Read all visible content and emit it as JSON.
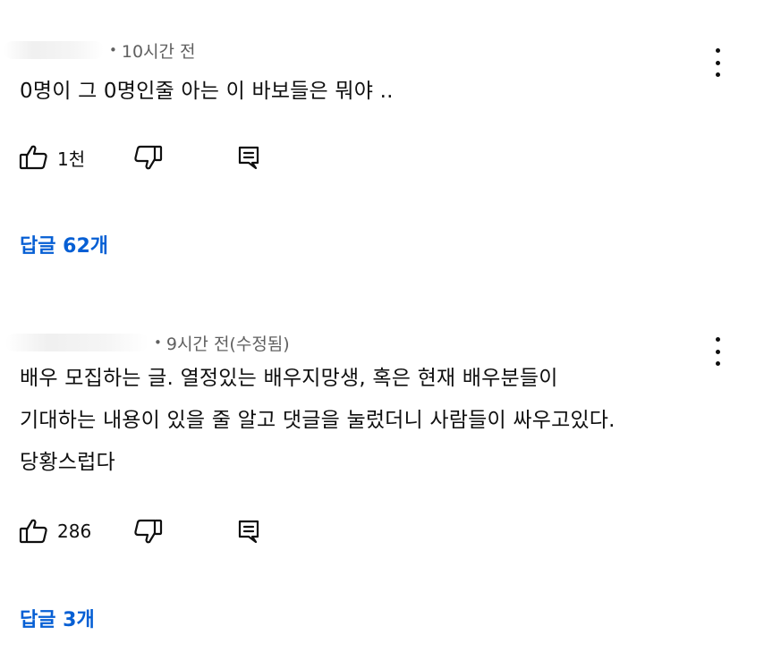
{
  "comments": [
    {
      "time": "10시간 전",
      "body": [
        "0명이 그 0명인줄 아는 이 바보들은 뭐야 .."
      ],
      "likes": "1천",
      "replies": "답글 62개"
    },
    {
      "time": "9시간 전(수정됨)",
      "body": [
        "배우 모집하는 글. 열정있는 배우지망생, 혹은 현재 배우분들이",
        "기대하는 내용이 있을 줄 알고 댓글을 눌렀더니 사람들이 싸우고있다.",
        "당황스럽다"
      ],
      "likes": "286",
      "replies": "답글 3개"
    }
  ],
  "colors": {
    "text": "#0f0f0f",
    "secondary": "#606060",
    "link": "#065fd4",
    "background": "#ffffff"
  },
  "icons": [
    "thumbs-up-icon",
    "thumbs-down-icon",
    "reply-icon",
    "more-vert-icon"
  ]
}
